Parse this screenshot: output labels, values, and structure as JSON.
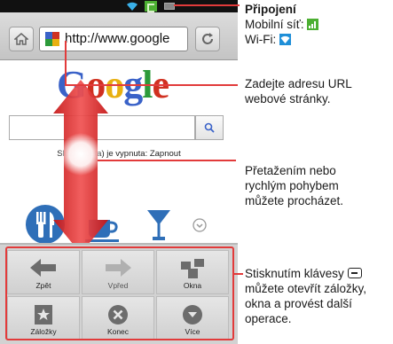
{
  "browser": {
    "url": "http://www.google",
    "services_text": "Služba      beta) je vypnuta: Zapnout",
    "logo_text": "Google"
  },
  "menu": {
    "items": [
      {
        "label": "Zpět",
        "icon": "back-arrow-icon"
      },
      {
        "label": "Vpřed",
        "icon": "forward-arrow-icon"
      },
      {
        "label": "Okna",
        "icon": "windows-icon"
      },
      {
        "label": "Záložky",
        "icon": "bookmark-icon"
      },
      {
        "label": "Konec",
        "icon": "close-circle-icon"
      },
      {
        "label": "Více",
        "icon": "more-circle-icon"
      }
    ]
  },
  "annotations": {
    "connection_title": "Připojení",
    "mobile_network": "Mobilní síť:",
    "wifi": "Wi-Fi:",
    "url_hint": "Zadejte adresu URL webové stránky.",
    "scroll_hint": "Přetažením nebo rychlým pohybem můžete procházet.",
    "menu_hint_before": "Stisknutím klávesy",
    "menu_hint_after": "můžete otevřít záložky, okna a provést další operace."
  },
  "colors": {
    "callout": "#e23b3b",
    "network": "#4caf32",
    "wifi": "#1f8fd8"
  }
}
